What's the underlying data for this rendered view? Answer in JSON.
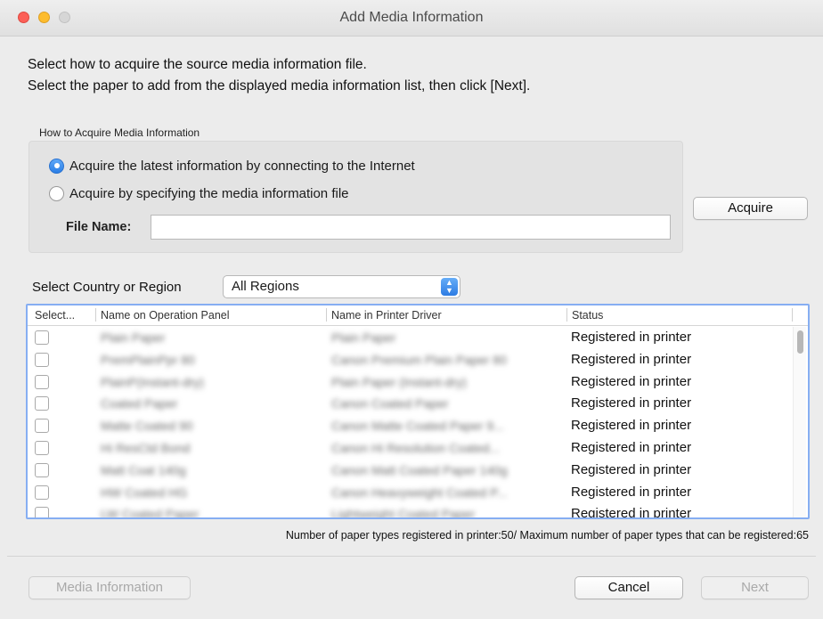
{
  "window": {
    "title": "Add Media Information"
  },
  "instructions": [
    "Select how to acquire the source media information file.",
    "Select the paper to add from the displayed media information list, then click [Next]."
  ],
  "acquire_group": {
    "label": "How to Acquire Media Information",
    "options": [
      {
        "label": "Acquire the latest information by connecting to the Internet",
        "selected": true
      },
      {
        "label": "Acquire by specifying the media information file",
        "selected": false
      }
    ],
    "file_name_label": "File Name:",
    "file_name_value": ""
  },
  "acquire_button": "Acquire",
  "country": {
    "label": "Select Country or Region",
    "selected": "All Regions"
  },
  "table": {
    "columns": [
      "Select...",
      "Name on Operation Panel",
      "Name in Printer Driver",
      "Status"
    ],
    "rows": [
      {
        "panel_name": "Plain Paper",
        "driver_name": "Plain Paper",
        "status": "Registered in printer"
      },
      {
        "panel_name": "PremPlainPpr 80",
        "driver_name": "Canon Premium Plain Paper 80",
        "status": "Registered in printer"
      },
      {
        "panel_name": "PlainP(Instant-dry)",
        "driver_name": "Plain Paper (Instant-dry)",
        "status": "Registered in printer"
      },
      {
        "panel_name": "Coated Paper",
        "driver_name": "Canon Coated Paper",
        "status": "Registered in printer"
      },
      {
        "panel_name": "Matte Coated 90",
        "driver_name": "Canon Matte Coated Paper 9...",
        "status": "Registered in printer"
      },
      {
        "panel_name": "Hi ResCtd Bond",
        "driver_name": "Canon Hi Resolution Coated...",
        "status": "Registered in printer"
      },
      {
        "panel_name": "Matt Coat 140g",
        "driver_name": "Canon Matt Coated Paper 140g",
        "status": "Registered in printer"
      },
      {
        "panel_name": "HW Coated HG",
        "driver_name": "Canon Heavyweight Coated P...",
        "status": "Registered in printer"
      },
      {
        "panel_name": "LW Coated Paper",
        "driver_name": "Lightweight Coated Paper",
        "status": "Registered in printer"
      }
    ]
  },
  "footnote": "Number of paper types registered in printer:50/ Maximum number of paper types that can be registered:65",
  "buttons": {
    "media_info": "Media Information",
    "cancel": "Cancel",
    "next": "Next"
  },
  "colors": {
    "accent": "#2a7ee6",
    "close": "#fc5f57",
    "minimize": "#fdbc2e",
    "zoom": "#d6d6d6",
    "table_focus": "#86aef2"
  }
}
